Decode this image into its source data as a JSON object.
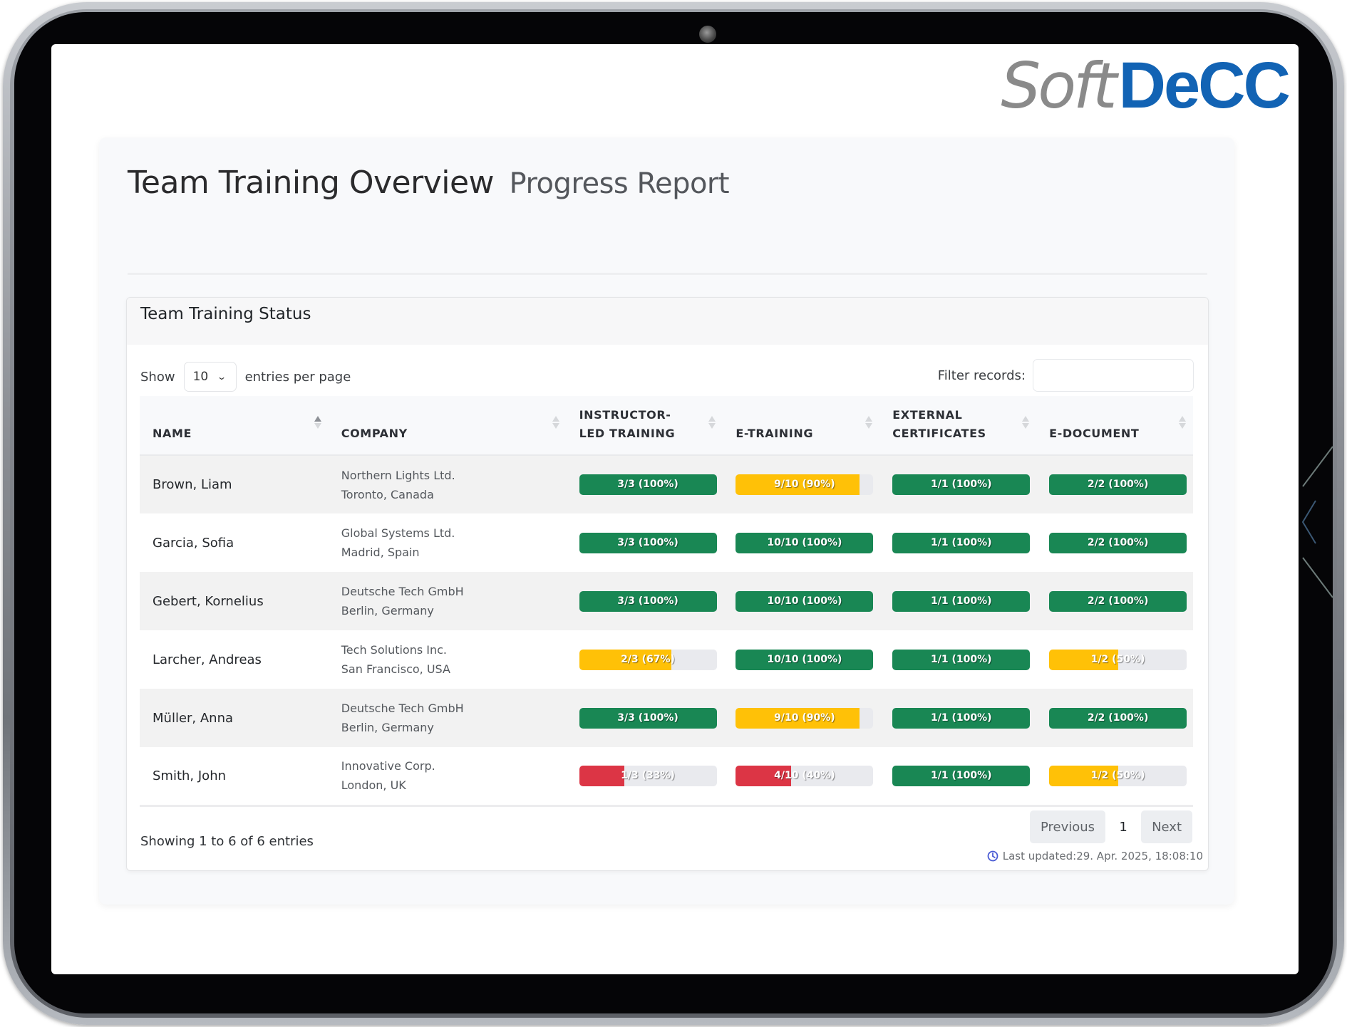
{
  "logo": {
    "part1": "Soft",
    "part2": "DeCC",
    "colors": {
      "soft": "#8a8a8a",
      "decc": "#1263b4"
    }
  },
  "page": {
    "title": "Team Training Overview",
    "subtitle": "Progress Report"
  },
  "card": {
    "title": "Team Training Status"
  },
  "controls": {
    "show_label": "Show",
    "entries_value": "10",
    "entries_suffix": "entries per page",
    "filter_label": "Filter records:",
    "filter_value": "",
    "filter_placeholder": ""
  },
  "table": {
    "columns": [
      {
        "key": "name",
        "label": "NAME",
        "sorted": "asc"
      },
      {
        "key": "company",
        "label": "COMPANY",
        "sorted": "none"
      },
      {
        "key": "ilt",
        "label": "INSTRUCTOR-LED TRAINING",
        "sorted": "none"
      },
      {
        "key": "etraining",
        "label": "E-TRAINING",
        "sorted": "none"
      },
      {
        "key": "extcert",
        "label": "EXTERNAL CERTIFICATES",
        "sorted": "none"
      },
      {
        "key": "edoc",
        "label": "E-DOCUMENT",
        "sorted": "none"
      }
    ],
    "rows": [
      {
        "name": "Brown, Liam",
        "company": "Northern Lights Ltd.",
        "location": "Toronto, Canada",
        "ilt": {
          "label": "3/3 (100%)",
          "percent": 100,
          "status": "complete"
        },
        "etraining": {
          "label": "9/10 (90%)",
          "percent": 90,
          "status": "partial"
        },
        "extcert": {
          "label": "1/1 (100%)",
          "percent": 100,
          "status": "complete"
        },
        "edoc": {
          "label": "2/2 (100%)",
          "percent": 100,
          "status": "complete"
        }
      },
      {
        "name": "Garcia, Sofia",
        "company": "Global Systems Ltd.",
        "location": "Madrid, Spain",
        "ilt": {
          "label": "3/3 (100%)",
          "percent": 100,
          "status": "complete"
        },
        "etraining": {
          "label": "10/10 (100%)",
          "percent": 100,
          "status": "complete"
        },
        "extcert": {
          "label": "1/1 (100%)",
          "percent": 100,
          "status": "complete"
        },
        "edoc": {
          "label": "2/2 (100%)",
          "percent": 100,
          "status": "complete"
        }
      },
      {
        "name": "Gebert, Kornelius",
        "company": "Deutsche Tech GmbH",
        "location": "Berlin, Germany",
        "ilt": {
          "label": "3/3 (100%)",
          "percent": 100,
          "status": "complete"
        },
        "etraining": {
          "label": "10/10 (100%)",
          "percent": 100,
          "status": "complete"
        },
        "extcert": {
          "label": "1/1 (100%)",
          "percent": 100,
          "status": "complete"
        },
        "edoc": {
          "label": "2/2 (100%)",
          "percent": 100,
          "status": "complete"
        }
      },
      {
        "name": "Larcher, Andreas",
        "company": "Tech Solutions Inc.",
        "location": "San Francisco, USA",
        "ilt": {
          "label": "2/3 (67%)",
          "percent": 67,
          "status": "partial"
        },
        "etraining": {
          "label": "10/10 (100%)",
          "percent": 100,
          "status": "complete"
        },
        "extcert": {
          "label": "1/1 (100%)",
          "percent": 100,
          "status": "complete"
        },
        "edoc": {
          "label": "1/2 (50%)",
          "percent": 50,
          "status": "partial"
        }
      },
      {
        "name": "Müller, Anna",
        "company": "Deutsche Tech GmbH",
        "location": "Berlin, Germany",
        "ilt": {
          "label": "3/3 (100%)",
          "percent": 100,
          "status": "complete"
        },
        "etraining": {
          "label": "9/10 (90%)",
          "percent": 90,
          "status": "partial"
        },
        "extcert": {
          "label": "1/1 (100%)",
          "percent": 100,
          "status": "complete"
        },
        "edoc": {
          "label": "2/2 (100%)",
          "percent": 100,
          "status": "complete"
        }
      },
      {
        "name": "Smith, John",
        "company": "Innovative Corp.",
        "location": "London, UK",
        "ilt": {
          "label": "1/3 (33%)",
          "percent": 33,
          "status": "low"
        },
        "etraining": {
          "label": "4/10 (40%)",
          "percent": 40,
          "status": "low"
        },
        "extcert": {
          "label": "1/1 (100%)",
          "percent": 100,
          "status": "complete"
        },
        "edoc": {
          "label": "1/2 (50%)",
          "percent": 50,
          "status": "partial"
        }
      }
    ]
  },
  "status_colors": {
    "complete": "#198754",
    "partial": "#ffc107",
    "low": "#dc3545",
    "track": "#e9eaee"
  },
  "footer": {
    "info": "Showing 1 to 6 of 6 entries",
    "previous_label": "Previous",
    "current_page": "1",
    "next_label": "Next"
  },
  "last_updated": {
    "icon": "clock-icon",
    "label": "Last updated:",
    "value": "29. Apr. 2025, 18:08:10"
  }
}
